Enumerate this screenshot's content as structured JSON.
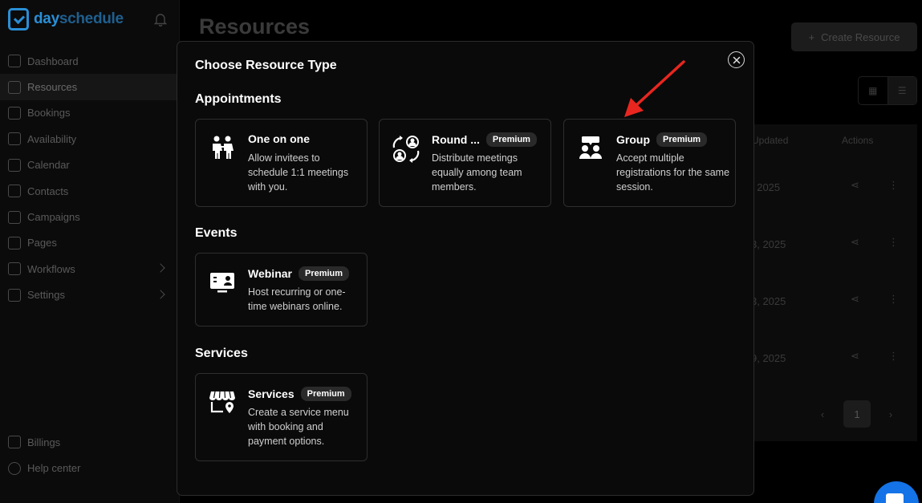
{
  "app": {
    "brand": {
      "part1": "day",
      "part2": "schedule"
    },
    "nav": [
      {
        "label": "Dashboard",
        "icon": "chart-line-icon"
      },
      {
        "label": "Resources",
        "icon": "folder-icon",
        "active": true
      },
      {
        "label": "Bookings",
        "icon": "calendar-check-icon"
      },
      {
        "label": "Availability",
        "icon": "calendar-clock-icon"
      },
      {
        "label": "Calendar",
        "icon": "calendar-icon"
      },
      {
        "label": "Contacts",
        "icon": "contact-card-icon"
      },
      {
        "label": "Campaigns",
        "icon": "rocket-icon"
      },
      {
        "label": "Pages",
        "icon": "globe-icon"
      },
      {
        "label": "Workflows",
        "icon": "workflow-icon",
        "expandable": true
      },
      {
        "label": "Settings",
        "icon": "sliders-icon",
        "expandable": true
      }
    ],
    "nav_bottom": [
      {
        "label": "Billings",
        "icon": "credit-card-icon"
      },
      {
        "label": "Help center",
        "icon": "help-circle-icon"
      }
    ]
  },
  "main": {
    "title": "Resources",
    "create_button": "Create Resource",
    "create_icon": "+",
    "table": {
      "headers": [
        "Updated",
        "Actions"
      ],
      "rows": [
        {
          "date": ", 2025"
        },
        {
          "date": "3, 2025"
        },
        {
          "date": "3, 2025"
        },
        {
          "date": "9, 2025"
        }
      ]
    },
    "pagination": {
      "prev": "‹",
      "current": "1",
      "next": "›"
    }
  },
  "modal": {
    "title": "Choose Resource Type",
    "sections": {
      "appointments": "Appointments",
      "events": "Events",
      "services": "Services"
    },
    "cards": {
      "one_on_one": {
        "title": "One on one",
        "badge": "",
        "desc": "Allow invitees to schedule 1:1 meetings with you."
      },
      "round": {
        "title": "Round ...",
        "badge": "Premium",
        "desc": "Distribute meetings equally among team members."
      },
      "group": {
        "title": "Group",
        "badge": "Premium",
        "desc": "Accept multiple registrations for the same session."
      },
      "webinar": {
        "title": "Webinar",
        "badge": "Premium",
        "desc": "Host recurring or one-time webinars online."
      },
      "services": {
        "title": "Services",
        "badge": "Premium",
        "desc": "Create a service menu with booking and payment options."
      }
    }
  },
  "colors": {
    "brand": "#2a8fd6",
    "annotation_arrow": "#e8261f",
    "chat": "#1473e6"
  }
}
